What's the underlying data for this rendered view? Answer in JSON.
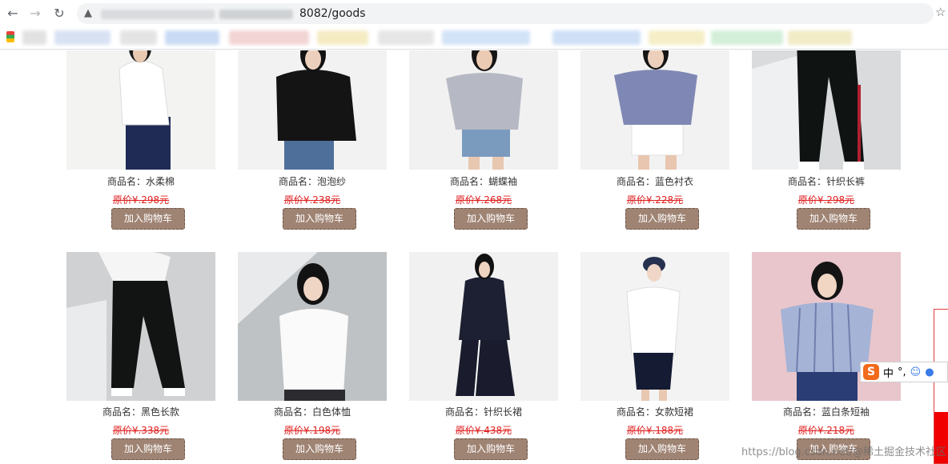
{
  "browser": {
    "url_visible": "8082/goods",
    "back_icon": "←",
    "forward_icon": "→",
    "reload_icon": "↻",
    "warning_icon": "▲",
    "bookmark_icon": "☆"
  },
  "product_row_1": [
    {
      "name": "商品名：水柔棉",
      "price": "原价¥.298元",
      "button": "加入购物车"
    },
    {
      "name": "商品名：泡泡纱",
      "price": "原价¥.238元",
      "button": "加入购物车"
    },
    {
      "name": "商品名：蝴蝶袖",
      "price": "原价¥.268元",
      "button": "加入购物车"
    },
    {
      "name": "商品名：蓝色衬衣",
      "price": "原价¥.228元",
      "button": "加入购物车"
    },
    {
      "name": "商品名：针织长裤",
      "price": "原价¥.298元",
      "button": "加入购物车"
    }
  ],
  "product_row_2": [
    {
      "name": "商品名：黑色长款",
      "price": "原价¥.338元",
      "button": "加入购物车"
    },
    {
      "name": "商品名：白色体恤",
      "price": "原价¥.198元",
      "button": "加入购物车"
    },
    {
      "name": "商品名：针织长裙",
      "price": "原价¥.438元",
      "button": "加入购物车"
    },
    {
      "name": "商品名：女款短裙",
      "price": "原价¥.188元",
      "button": "加入购物车"
    },
    {
      "name": "商品名：蓝白条短袖",
      "price": "原价¥.218元",
      "button": "加入购物车"
    }
  ],
  "ime": {
    "logo": "S",
    "mode": "中",
    "punct": "°,"
  },
  "watermark": "https://blog.csdn.net/@稀土掘金技术社区",
  "colors": {
    "button_bg": "#9f8373",
    "price_red": "#e02020",
    "ime_orange": "#f26b1d"
  }
}
